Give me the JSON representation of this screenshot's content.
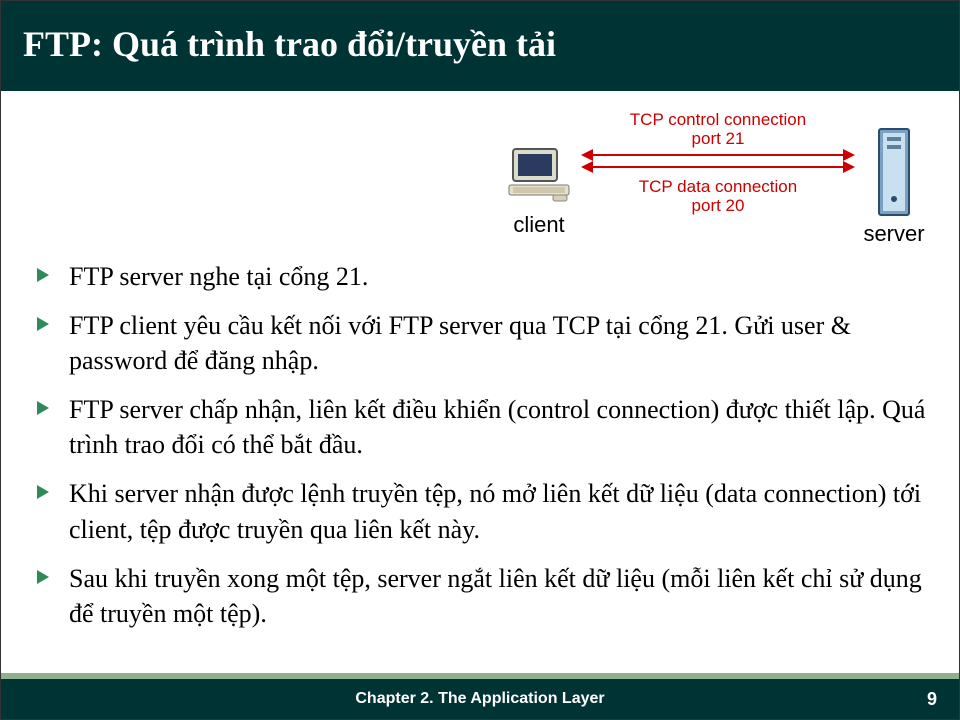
{
  "title": "FTP: Quá trình trao đổi/truyền tải",
  "diagram": {
    "client_label": "client",
    "server_label": "server",
    "control_line1": "TCP control connection",
    "control_line2": "port 21",
    "data_line1": "TCP data connection",
    "data_line2": "port 20"
  },
  "bullets": [
    "FTP server nghe tại cổng 21.",
    "FTP client yêu cầu kết nối với FTP server qua TCP tại cổng 21. Gửi user & password để đăng nhập.",
    "FTP server chấp nhận, liên kết điều khiển (control connection) được thiết lập. Quá trình trao đổi có thể bắt đầu.",
    "Khi server nhận được lệnh truyền tệp, nó mở liên kết dữ liệu (data connection) tới client, tệp được truyền qua liên kết này.",
    "Sau khi truyền xong một tệp, server ngắt liên kết dữ liệu (mỗi liên kết chỉ sử dụng để truyền một tệp)."
  ],
  "footer": {
    "chapter": "Chapter 2. The Application Layer",
    "page": "9"
  }
}
